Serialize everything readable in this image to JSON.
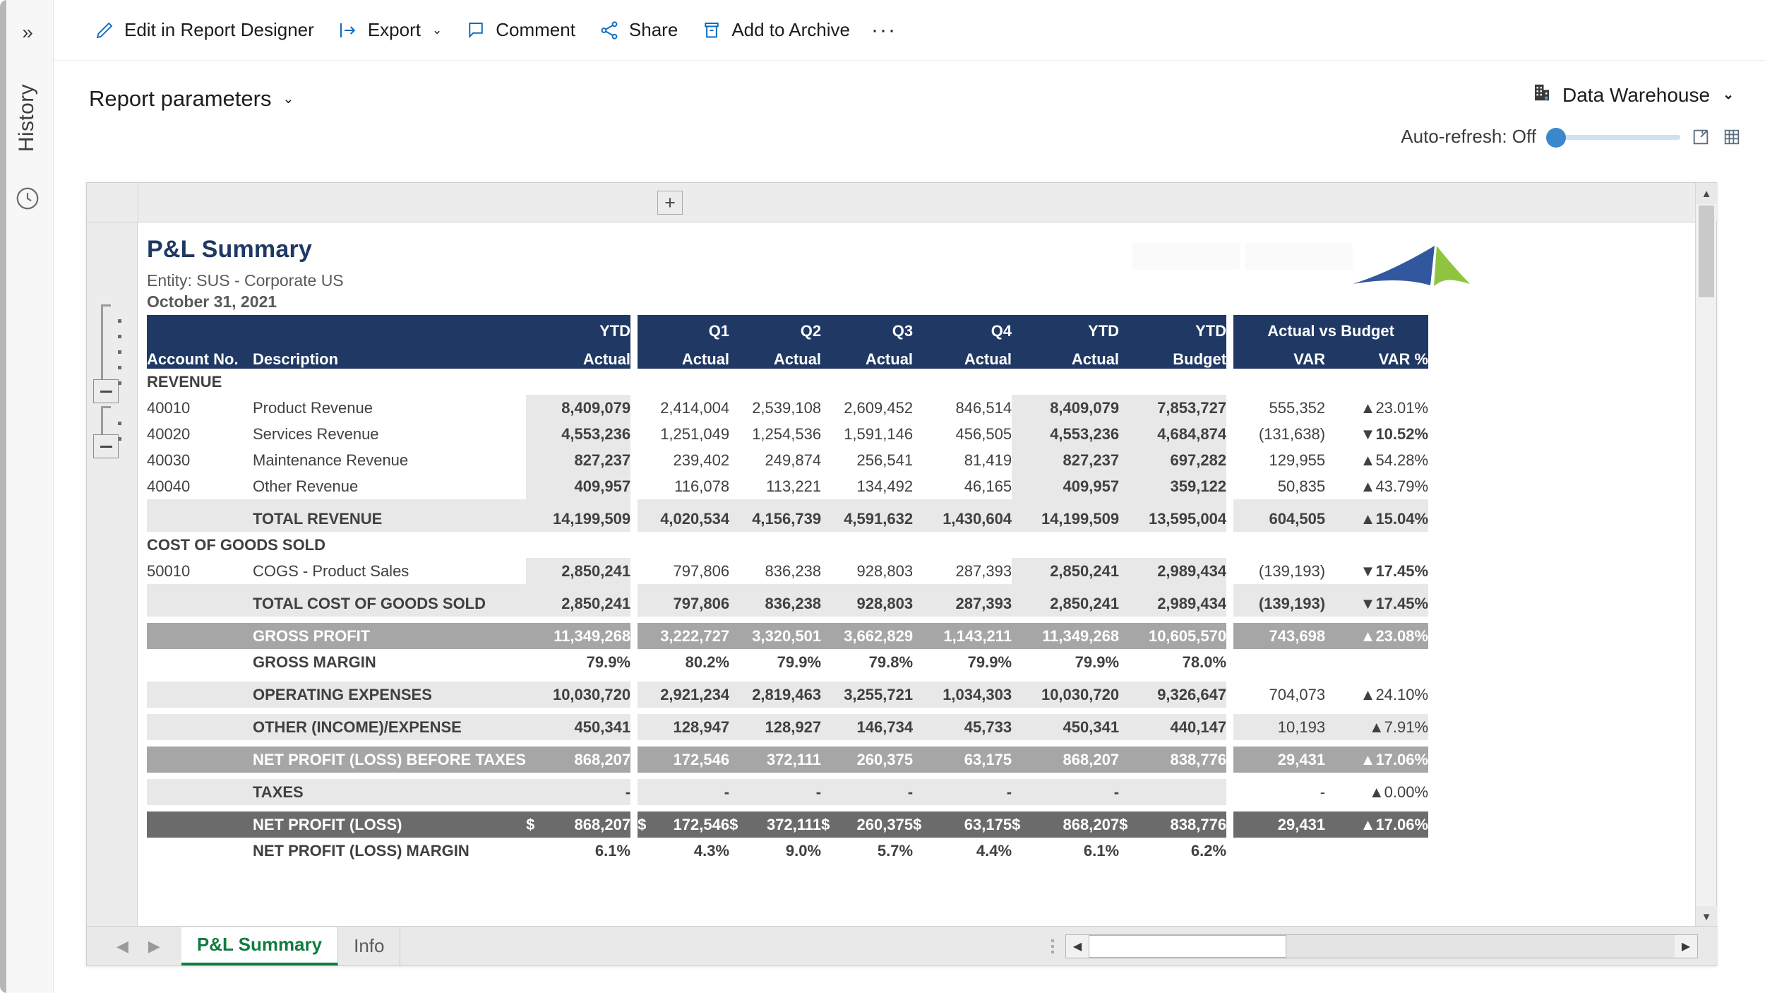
{
  "rail": {
    "expand_icon": "chevron-double-right",
    "history_label": "History",
    "clock_icon": "clock-icon"
  },
  "command_bar": {
    "items": [
      {
        "label": "Edit in Report Designer",
        "icon": "pencil-icon",
        "caret": ""
      },
      {
        "label": "Export",
        "icon": "export-icon",
        "caret": "⌄"
      },
      {
        "label": "Comment",
        "icon": "comment-icon",
        "caret": ""
      },
      {
        "label": "Share",
        "icon": "share-icon",
        "caret": ""
      },
      {
        "label": "Add to Archive",
        "icon": "archive-icon",
        "caret": ""
      }
    ],
    "overflow_label": "···"
  },
  "params": {
    "report_parameters_label": "Report parameters",
    "caret": "⌄",
    "data_source_label": "Data Warehouse",
    "data_source_icon": "building-icon",
    "data_source_caret": "⌄",
    "auto_refresh_label": "Auto-refresh: Off",
    "export_icon": "export-box-icon",
    "grid_icon": "grid-icon"
  },
  "toolbar": {
    "plus_label": "+"
  },
  "report": {
    "title": "P&L Summary",
    "entity": "Entity: SUS - Corporate US",
    "date": "October 31, 2021",
    "logo_name": "company-logo"
  },
  "table": {
    "header_top": [
      "",
      "",
      "YTD",
      "Q1",
      "Q2",
      "Q3",
      "Q4",
      "YTD",
      "YTD",
      "Actual vs Budget"
    ],
    "header_bottom": [
      "Account No.",
      "Description",
      "Actual",
      "Actual",
      "Actual",
      "Actual",
      "Actual",
      "Actual",
      "Budget",
      "VAR",
      "VAR %"
    ],
    "group_actual_vs_budget": "Actual vs Budget",
    "sections": [
      {
        "heading": "REVENUE",
        "rows": [
          {
            "acct": "40010",
            "desc": "Product Revenue",
            "ytd_actual": "8,409,079",
            "q1": "2,414,004",
            "q2": "2,539,108",
            "q3": "2,609,452",
            "q4": "846,514",
            "ytd2": "8,409,079",
            "budget": "7,853,727",
            "var": "555,352",
            "varpct": "23.01%",
            "dir": "up"
          },
          {
            "acct": "40020",
            "desc": "Services Revenue",
            "ytd_actual": "4,553,236",
            "q1": "1,251,049",
            "q2": "1,254,536",
            "q3": "1,591,146",
            "q4": "456,505",
            "ytd2": "4,553,236",
            "budget": "4,684,874",
            "var": "(131,638)",
            "varpct": "10.52%",
            "dir": "down"
          },
          {
            "acct": "40030",
            "desc": "Maintenance Revenue",
            "ytd_actual": "827,237",
            "q1": "239,402",
            "q2": "249,874",
            "q3": "256,541",
            "q4": "81,419",
            "ytd2": "827,237",
            "budget": "697,282",
            "var": "129,955",
            "varpct": "54.28%",
            "dir": "up"
          },
          {
            "acct": "40040",
            "desc": "Other Revenue",
            "ytd_actual": "409,957",
            "q1": "116,078",
            "q2": "113,221",
            "q3": "134,492",
            "q4": "46,165",
            "ytd2": "409,957",
            "budget": "359,122",
            "var": "50,835",
            "varpct": "43.79%",
            "dir": "up"
          }
        ],
        "total": {
          "desc": "TOTAL REVENUE",
          "ytd_actual": "14,199,509",
          "q1": "4,020,534",
          "q2": "4,156,739",
          "q3": "4,591,632",
          "q4": "1,430,604",
          "ytd2": "14,199,509",
          "budget": "13,595,004",
          "var": "604,505",
          "varpct": "15.04%",
          "dir": "up"
        }
      },
      {
        "heading": "COST OF GOODS SOLD",
        "rows": [
          {
            "acct": "50010",
            "desc": "COGS - Product Sales",
            "ytd_actual": "2,850,241",
            "q1": "797,806",
            "q2": "836,238",
            "q3": "928,803",
            "q4": "287,393",
            "ytd2": "2,850,241",
            "budget": "2,989,434",
            "var": "(139,193)",
            "varpct": "17.45%",
            "dir": "down"
          }
        ],
        "total": {
          "desc": "TOTAL COST OF GOODS SOLD",
          "ytd_actual": "2,850,241",
          "q1": "797,806",
          "q2": "836,238",
          "q3": "928,803",
          "q4": "287,393",
          "ytd2": "2,850,241",
          "budget": "2,989,434",
          "var": "(139,193)",
          "varpct": "17.45%",
          "dir": "down"
        }
      }
    ],
    "summary_rows": [
      {
        "style": "band-med",
        "desc": "GROSS PROFIT",
        "ytd_actual": "11,349,268",
        "q1": "3,222,727",
        "q2": "3,320,501",
        "q3": "3,662,829",
        "q4": "1,143,211",
        "ytd2": "11,349,268",
        "budget": "10,605,570",
        "var": "743,698",
        "varpct": "23.08%",
        "dir": "up"
      },
      {
        "style": "plain",
        "desc": "GROSS MARGIN",
        "ytd_actual": "79.9%",
        "q1": "80.2%",
        "q2": "79.9%",
        "q3": "79.8%",
        "q4": "79.9%",
        "ytd2": "79.9%",
        "budget": "78.0%",
        "var": "",
        "varpct": "",
        "dir": "none"
      },
      {
        "style": "band-light",
        "desc": "OPERATING EXPENSES",
        "ytd_actual": "10,030,720",
        "q1": "2,921,234",
        "q2": "2,819,463",
        "q3": "3,255,721",
        "q4": "1,034,303",
        "ytd2": "10,030,720",
        "budget": "9,326,647",
        "var": "704,073",
        "varpct": "24.10%",
        "dir": "up"
      },
      {
        "style": "band-light",
        "desc": "OTHER (INCOME)/EXPENSE",
        "ytd_actual": "450,341",
        "q1": "128,947",
        "q2": "128,927",
        "q3": "146,734",
        "q4": "45,733",
        "ytd2": "450,341",
        "budget": "440,147",
        "var": "10,193",
        "varpct": "7.91%",
        "dir": "up"
      },
      {
        "style": "band-med",
        "desc": "NET PROFIT (LOSS) BEFORE TAXES",
        "ytd_actual": "868,207",
        "q1": "172,546",
        "q2": "372,111",
        "q3": "260,375",
        "q4": "63,175",
        "ytd2": "868,207",
        "budget": "838,776",
        "var": "29,431",
        "varpct": "17.06%",
        "dir": "up"
      },
      {
        "style": "band-light",
        "desc": "TAXES",
        "ytd_actual": "-",
        "q1": "-",
        "q2": "-",
        "q3": "-",
        "q4": "-",
        "ytd2": "-",
        "budget": "",
        "var": "-",
        "varpct": "0.00%",
        "dir": "up"
      },
      {
        "style": "band-dark",
        "desc": "NET PROFIT (LOSS)",
        "currency": "$",
        "ytd_actual": "868,207",
        "q1": "172,546",
        "q2": "372,111",
        "q3": "260,375",
        "q4": "63,175",
        "ytd2": "868,207",
        "budget": "838,776",
        "var": "29,431",
        "varpct": "17.06%",
        "dir": "up"
      },
      {
        "style": "plain",
        "desc": "NET PROFIT (LOSS) MARGIN",
        "ytd_actual": "6.1%",
        "q1": "4.3%",
        "q2": "9.0%",
        "q3": "5.7%",
        "q4": "4.4%",
        "ytd2": "6.1%",
        "budget": "6.2%",
        "var": "",
        "varpct": "",
        "dir": "none"
      }
    ],
    "arrow_up": "▲",
    "arrow_down": "▼"
  },
  "sheet_tabs": {
    "prev_icon": "◀",
    "next_icon": "▶",
    "tabs": [
      {
        "label": "P&L Summary",
        "active": true
      },
      {
        "label": "Info",
        "active": false
      }
    ]
  },
  "colors": {
    "header_blue": "#1f3864",
    "accent_green": "#107c41",
    "negative_red": "#ff0000",
    "band_medium": "#a6a6a6",
    "band_dark": "#6b6b6b"
  }
}
